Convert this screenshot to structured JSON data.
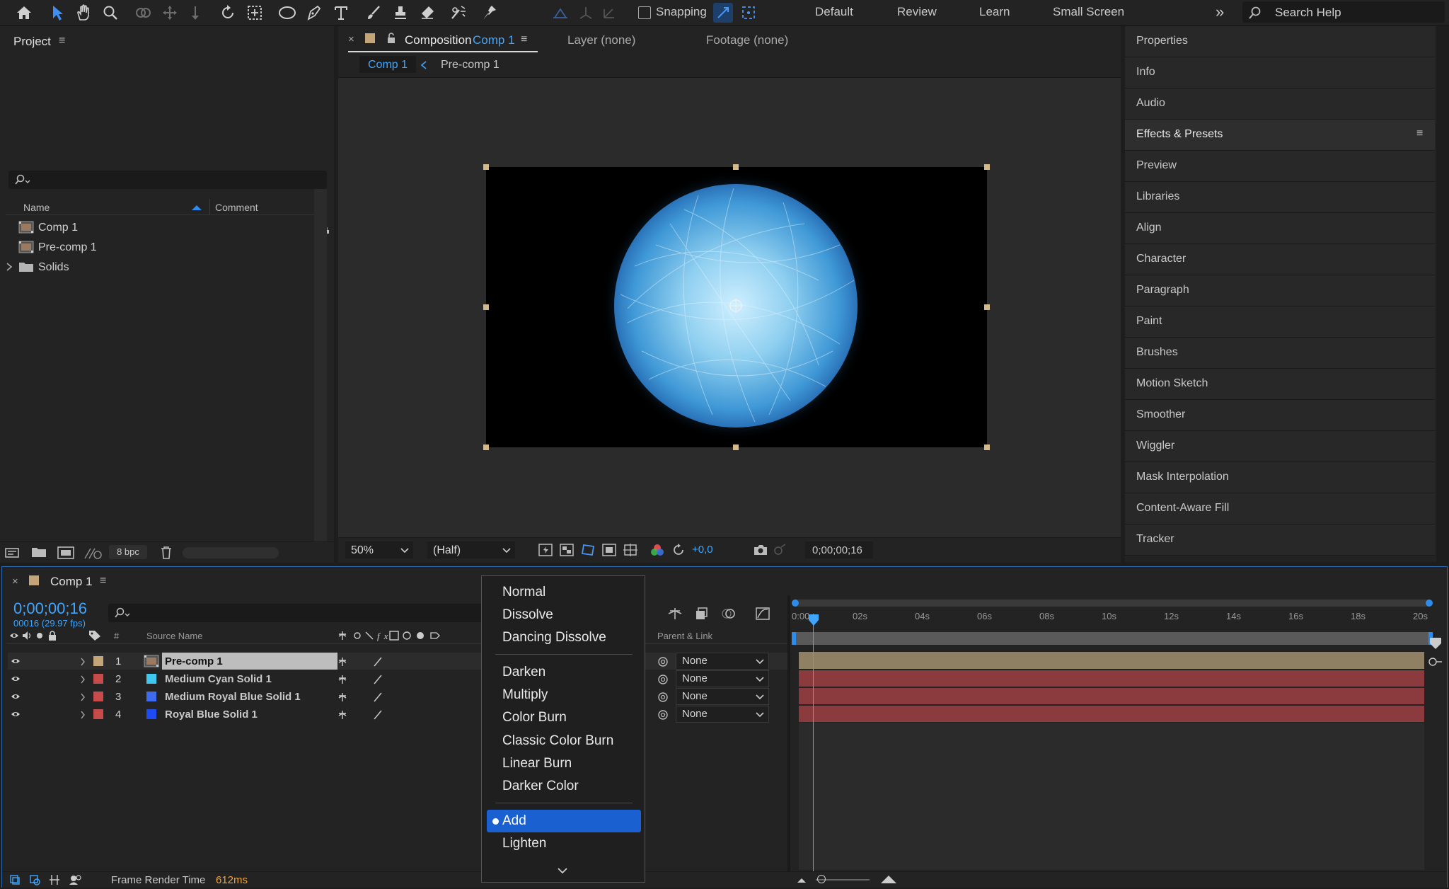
{
  "toolbar": {
    "snapping_label": "Snapping",
    "workspaces": [
      "Default",
      "Review",
      "Learn",
      "Small Screen"
    ],
    "search_placeholder": "Search Help"
  },
  "project": {
    "title": "Project",
    "columns": {
      "name": "Name",
      "comment": "Comment"
    },
    "items": [
      {
        "label": "Comp 1",
        "type": "composition"
      },
      {
        "label": "Pre-comp 1",
        "type": "composition"
      },
      {
        "label": "Solids",
        "type": "folder"
      }
    ],
    "bpc": "8 bpc"
  },
  "viewer": {
    "tab_label": "Composition",
    "tab_comp": "Comp 1",
    "layer_tab": "Layer (none)",
    "footage_tab": "Footage (none)",
    "breadcrumbs": [
      "Comp 1",
      "Pre-comp 1"
    ],
    "zoom": "50%",
    "resolution": "(Half)",
    "exposure": "+0,0",
    "timecode": "0;00;00;16"
  },
  "right_panel": {
    "items": [
      "Properties",
      "Info",
      "Audio",
      "Effects & Presets",
      "Preview",
      "Libraries",
      "Align",
      "Character",
      "Paragraph",
      "Paint",
      "Brushes",
      "Motion Sketch",
      "Smoother",
      "Wiggler",
      "Mask Interpolation",
      "Content-Aware Fill",
      "Tracker"
    ]
  },
  "timeline": {
    "comp_tab": "Comp 1",
    "timecode": "0;00;00;16",
    "frame_info": "00016 (29.97 fps)",
    "columns": {
      "num": "#",
      "source_name": "Source Name",
      "parent": "Parent & Link"
    },
    "layers": [
      {
        "num": "1",
        "name": "Pre-comp 1",
        "label_color": "#c4a57a",
        "swatch": "comp",
        "parent": "None"
      },
      {
        "num": "2",
        "name": "Medium Cyan Solid 1",
        "label_color": "#c84b4b",
        "swatch": "#3fc7f0",
        "parent": "None"
      },
      {
        "num": "3",
        "name": "Medium Royal Blue Solid 1",
        "label_color": "#c84b4b",
        "swatch": "#3f6bef",
        "parent": "None"
      },
      {
        "num": "4",
        "name": "Royal Blue Solid 1",
        "label_color": "#c84b4b",
        "swatch": "#1f4cf2",
        "parent": "None"
      }
    ],
    "ruler": [
      "0:00",
      "02s",
      "04s",
      "06s",
      "08s",
      "10s",
      "12s",
      "14s",
      "16s",
      "18s",
      "20s"
    ],
    "frame_render_label": "Frame Render Time",
    "frame_render_value": "612ms"
  },
  "blend_menu": {
    "group1": [
      "Normal",
      "Dissolve",
      "Dancing Dissolve"
    ],
    "group2": [
      "Darken",
      "Multiply",
      "Color Burn",
      "Classic Color Burn",
      "Linear Burn",
      "Darker Color"
    ],
    "group3": [
      "Add",
      "Lighten"
    ],
    "selected": "Add"
  },
  "colors": {
    "accent": "#2d8ceb",
    "selected_menu": "#1a60d1",
    "track_red": "#8b3a3e",
    "track_tan": "#8f7f63",
    "timecode": "#3ea6ff"
  }
}
